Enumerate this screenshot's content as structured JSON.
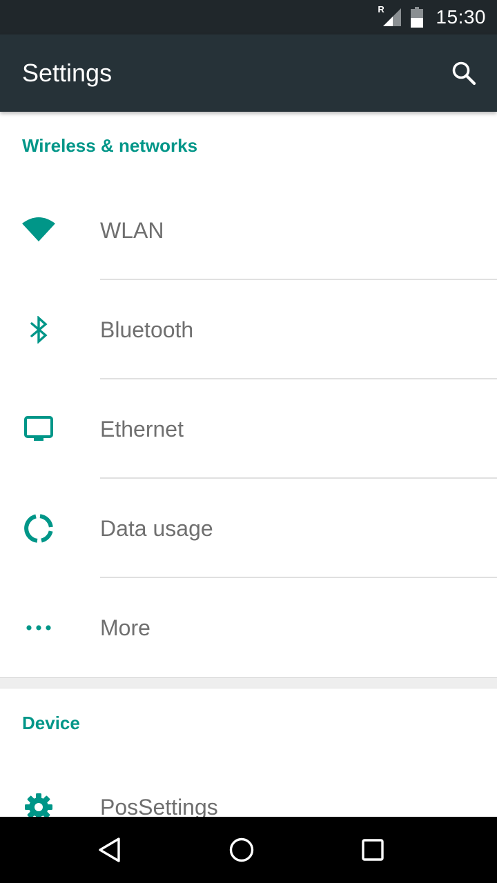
{
  "status_bar": {
    "time": "15:30",
    "roaming_indicator": "R",
    "icons": [
      "roaming-signal-icon",
      "battery-icon"
    ]
  },
  "app_bar": {
    "title": "Settings",
    "search_icon": "search-icon"
  },
  "sections": [
    {
      "header": "Wireless & networks",
      "items": [
        {
          "label": "WLAN",
          "icon": "wifi-icon"
        },
        {
          "label": "Bluetooth",
          "icon": "bluetooth-icon"
        },
        {
          "label": "Ethernet",
          "icon": "monitor-icon"
        },
        {
          "label": "Data usage",
          "icon": "data-usage-icon"
        },
        {
          "label": "More",
          "icon": "more-dots-icon"
        }
      ]
    },
    {
      "header": "Device",
      "items": [
        {
          "label": "PosSettings",
          "icon": "gear-icon"
        }
      ]
    }
  ],
  "nav_bar": {
    "icons": [
      "back-icon",
      "home-icon",
      "recents-icon"
    ]
  },
  "colors": {
    "accent": "#009688",
    "app_bar": "#263238",
    "status_bar": "#20272b",
    "item_text": "#6f6f6f",
    "nav_bar": "#000000"
  }
}
